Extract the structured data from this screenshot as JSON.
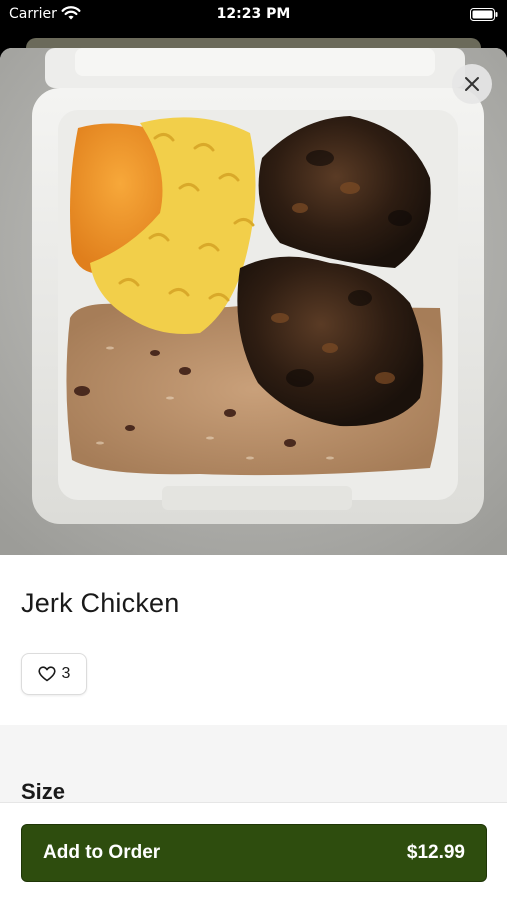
{
  "status_bar": {
    "carrier": "Carrier",
    "time": "12:23 PM",
    "wifi_icon": "wifi-icon",
    "battery_icon": "battery-icon"
  },
  "item": {
    "title": "Jerk Chicken",
    "image_icon": "food-photo",
    "like_count": "3",
    "like_icon": "heart-outline-icon",
    "close_icon": "close-icon"
  },
  "options": {
    "size_heading": "Size"
  },
  "order": {
    "add_label": "Add to Order",
    "price": "$12.99",
    "button_color": "#2e4d0e"
  }
}
